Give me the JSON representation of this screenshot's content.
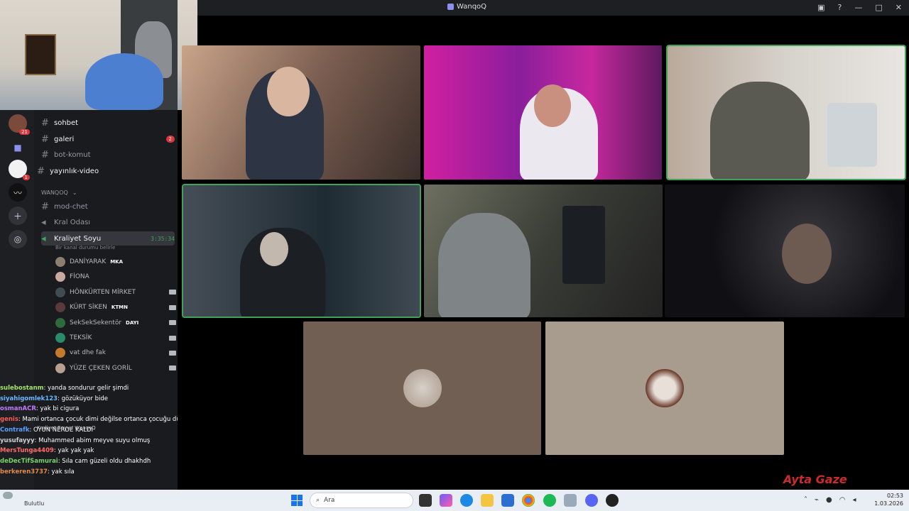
{
  "window": {
    "title": "WanqoQ"
  },
  "rail": {
    "server_badge": "21",
    "dm_badge": "1"
  },
  "channels": {
    "sohbet": "sohbet",
    "galeri": "galeri",
    "galeri_badge": "2",
    "bot_komut": "bot-komut",
    "yayinlik": "yayınlık-video",
    "category": "WANQOQ",
    "mod_chet": "mod-chet",
    "kral_odasi": "Kral Odası",
    "kraliyet_soyu": "Kraliyet Soyu",
    "timer": "3:35:34",
    "status_placeholder": "Bir kanal durumu belirle"
  },
  "members": [
    {
      "name": "DANİYARAK",
      "tag": "MKA",
      "cam": false,
      "color": "#8a7f70"
    },
    {
      "name": "FİONA",
      "tag": "",
      "cam": false,
      "color": "#c9a8a0"
    },
    {
      "name": "HÖNKÜRTEN MİRKET",
      "tag": "",
      "cam": true,
      "color": "#3f4c52"
    },
    {
      "name": "KÜRT SİKEN",
      "tag": "KTMN",
      "cam": true,
      "color": "#5a3a3a"
    },
    {
      "name": "SekSekSekentör",
      "tag": "DAYI",
      "cam": true,
      "color": "#2e6a3a"
    },
    {
      "name": "TEKSİK",
      "tag": "",
      "cam": true,
      "color": "#2b8a6a"
    },
    {
      "name": "vat dhe fak",
      "tag": "",
      "cam": true,
      "color": "#c47a2c"
    },
    {
      "name": "YÜZE ÇEKEN GORİL",
      "tag": "",
      "cam": true,
      "color": "#b8a090"
    }
  ],
  "chat": [
    {
      "user": "sulebostanm",
      "msg": ": yanda sondurur gelir şimdi",
      "color": "#a6e36b"
    },
    {
      "user": "siyahigomlek123",
      "msg": ": gözüküyor bide",
      "color": "#6bb6ff"
    },
    {
      "user": "osmanACR",
      "msg": ": yak bi cigura",
      "color": "#c07bff"
    },
    {
      "user": "genis",
      "msg": ": Mami ortanca çocuk dimi değilse ortanca çocuğu düşünemiyorum",
      "color": "#ff5a5a"
    },
    {
      "user": "Contrafk",
      "msg": ": OYUN NERDE KALDI",
      "color": "#5aa0ff"
    },
    {
      "user": "yusufayyy",
      "msg": ": Muhammed abim meyve suyu olmuş",
      "color": "#d0d0d0"
    },
    {
      "user": "MersTunga4409",
      "msg": ": yak yak yak",
      "color": "#ff6b6b"
    },
    {
      "user": "deDecTifSamurai",
      "msg": ": Sıla cam güzeli oldu dhakhdh",
      "color": "#7ad36b"
    },
    {
      "user": "berkeren3737",
      "msg": ": yak sıla",
      "color": "#e08a4a"
    }
  ],
  "voice_panel": {
    "channel_path": "Kraliyet Soyu / WanqoQ"
  },
  "taskbar": {
    "weather": "Bulutlu",
    "search_placeholder": "Ara",
    "time": "02:53",
    "date": "1.03.2026"
  },
  "watermark": "Ayta Gaze"
}
